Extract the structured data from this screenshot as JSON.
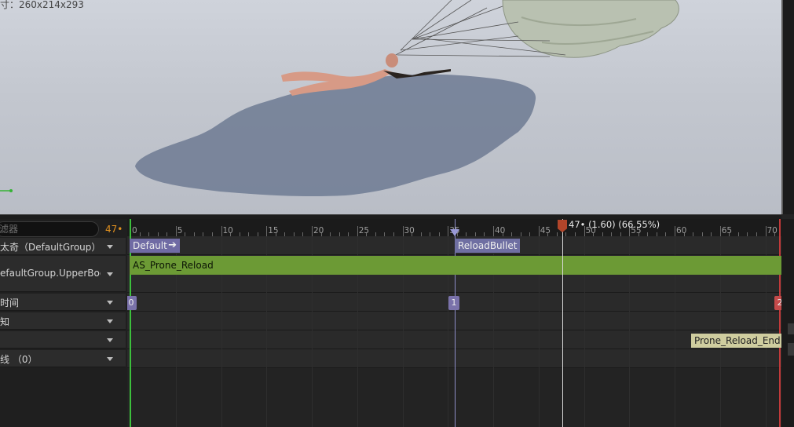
{
  "viewport": {
    "overlay_text": "寸：260x214x293"
  },
  "sidebar": {
    "search_placeholder": "滤器",
    "frame_count": "47•",
    "rows": [
      {
        "label": "太奇（DefaultGroup）"
      },
      {
        "label": "efaultGroup.UpperBody"
      },
      {
        "label": "时间"
      },
      {
        "label": "知"
      },
      {
        "label": ""
      },
      {
        "label": "线 （0）"
      }
    ]
  },
  "timeline": {
    "ruler_ticks": [
      "0",
      "5",
      "10",
      "15",
      "20",
      "25",
      "30",
      "35",
      "40",
      "45",
      "50",
      "55",
      "60",
      "65",
      "70"
    ],
    "playhead_readout": "47• (1.60) (66.55%)",
    "section_chip": "Default",
    "section_arrow": "➔",
    "notify_chip": "ReloadBullet",
    "anim_segment": "AS_Prone_Reload",
    "sections": [
      "0",
      "1",
      "2"
    ],
    "end_notify": "Prone_Reload_End"
  },
  "colors": {
    "accent_orange": "#e0901f",
    "segment_green": "#6c9a35",
    "section_purple": "#706ba4",
    "end_red": "#c44a4a",
    "playhead": "#b2452a"
  }
}
